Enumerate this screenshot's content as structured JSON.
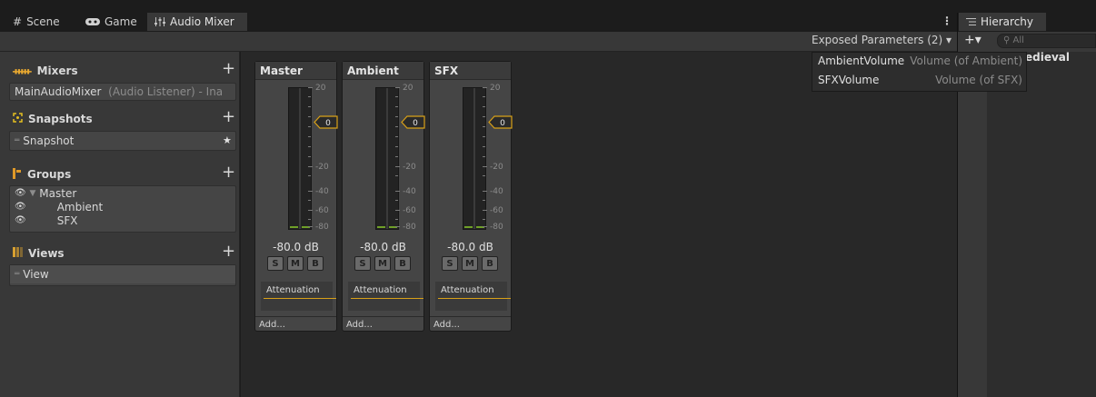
{
  "tabs": [
    {
      "label": "Scene",
      "icon": "grid-icon"
    },
    {
      "label": "Game",
      "icon": "gamepad-icon"
    },
    {
      "label": "Audio Mixer",
      "icon": "mixer-icon"
    }
  ],
  "hierarchy_tab": {
    "label": "Hierarchy",
    "icon": "list-icon"
  },
  "more_icon": "⋮",
  "left": {
    "mixers": {
      "title": "Mixers",
      "item": "MainAudioMixer",
      "item_suffix": "(Audio Listener) - Ina"
    },
    "snapshots": {
      "title": "Snapshots",
      "item": "Snapshot"
    },
    "groups": {
      "title": "Groups",
      "items": [
        "Master",
        "Ambient",
        "SFX"
      ]
    },
    "views": {
      "title": "Views",
      "item": "View"
    },
    "plus": "+"
  },
  "strips": [
    {
      "name": "Master",
      "db": "-80.0 dB",
      "fader": "0",
      "effect": "Attenuation",
      "add": "Add..."
    },
    {
      "name": "Ambient",
      "db": "-80.0 dB",
      "fader": "0",
      "effect": "Attenuation",
      "add": "Add..."
    },
    {
      "name": "SFX",
      "db": "-80.0 dB",
      "fader": "0",
      "effect": "Attenuation",
      "add": "Add..."
    }
  ],
  "buttons": {
    "solo": "S",
    "mute": "M",
    "bypass": "B"
  },
  "scale": {
    "top": "20",
    "t1": "-20",
    "t2": "-40",
    "t3": "-60",
    "t4": "-80"
  },
  "exposed": {
    "label": "Exposed Parameters (2) ▾",
    "params": [
      {
        "name": "AmbientVolume",
        "desc": "Volume (of Ambient)"
      },
      {
        "name": "SFXVolume",
        "desc": "Volume (of SFX)"
      }
    ]
  },
  "hierarchy": {
    "add": "+▾",
    "search_placeholder": "All",
    "item_partial": "edieval"
  },
  "colors": {
    "accent": "#d8a018",
    "meter_green": "#6fa028",
    "mixers_icon": "#e8a830",
    "snapshot_icon": "#e6c020",
    "groups_icon": "#e09a28",
    "views_icon": "#d8a030"
  }
}
